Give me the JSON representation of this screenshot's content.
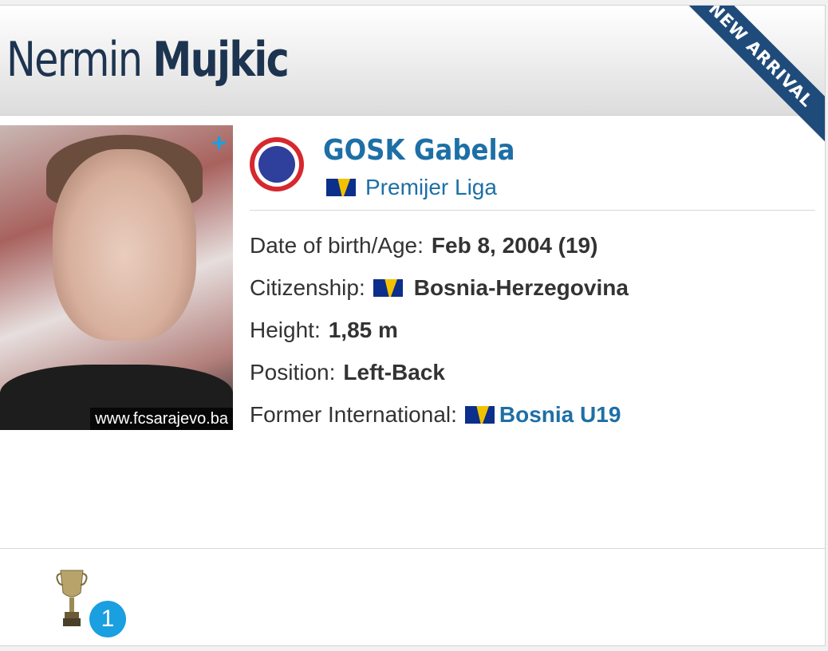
{
  "player": {
    "first_name": "Nermin",
    "last_name": "Mujkic",
    "ribbon": "NEW ARRIVAL",
    "photo_credit": "www.fcsarajevo.ba",
    "photo_action": "+"
  },
  "club": {
    "name": "GOSK Gabela",
    "league": "Premijer Liga",
    "league_flag": "bosnia-flag-icon"
  },
  "info": {
    "dob_label": "Date of birth/Age:",
    "dob_value": "Feb 8, 2004 (19)",
    "citizenship_label": "Citizenship:",
    "citizenship_value": "Bosnia-Herzegovina",
    "height_label": "Height:",
    "height_value": "1,85 m",
    "position_label": "Position:",
    "position_value": "Left-Back",
    "international_label": "Former International:",
    "international_value": "Bosnia U19"
  },
  "achievements": {
    "trophy_icon": "trophy-icon",
    "count": "1"
  },
  "colors": {
    "link": "#1d6fa6",
    "name": "#1d3450",
    "ribbon": "#1f4b7a",
    "badge": "#1a9fe0"
  }
}
